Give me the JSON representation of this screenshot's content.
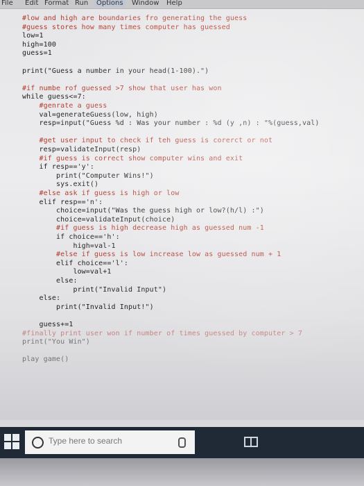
{
  "menu": {
    "file": "File",
    "edit": "Edit",
    "format": "Format",
    "run": "Run",
    "options": "Options",
    "window": "Window",
    "help": "Help"
  },
  "code": [
    {
      "text": "#low and high are boundaries fro generating the guess",
      "kind": "cm"
    },
    {
      "text": "#guess stores how many times computer has guessed",
      "kind": "cm"
    },
    {
      "text": "low=1",
      "kind": "plain"
    },
    {
      "text": "high=100",
      "kind": "plain"
    },
    {
      "text": "guess=1",
      "kind": "plain"
    },
    {
      "text": "",
      "kind": "plain"
    },
    {
      "text": "print(\"Guess a number in your head(1-100).\")",
      "kind": "plain"
    },
    {
      "text": "",
      "kind": "plain"
    },
    {
      "text": "#if numbe rof guessed >7 show that user has won",
      "kind": "cm"
    },
    {
      "text": "while guess<=7:",
      "kind": "plain"
    },
    {
      "text": "    #genrate a guess",
      "kind": "cm"
    },
    {
      "text": "    val=generateGuess(low, high)",
      "kind": "plain"
    },
    {
      "text": "    resp=input(\"Guess %d : Was your number : %d (y ,n) : \"%(guess,val)",
      "kind": "plain"
    },
    {
      "text": "",
      "kind": "plain"
    },
    {
      "text": "    #get user input to check if teh guess is corerct or not",
      "kind": "cm"
    },
    {
      "text": "    resp=validateInput(resp)",
      "kind": "plain"
    },
    {
      "text": "    #if guess is correct show computer wins and exit",
      "kind": "cm"
    },
    {
      "text": "    if resp=='y':",
      "kind": "plain"
    },
    {
      "text": "        print(\"Computer Wins!\")",
      "kind": "plain"
    },
    {
      "text": "        sys.exit()",
      "kind": "plain"
    },
    {
      "text": "    #else ask if guess is high or low",
      "kind": "cm"
    },
    {
      "text": "    elif resp=='n':",
      "kind": "plain"
    },
    {
      "text": "        choice=input(\"Was the guess high or low?(h/l) :\")",
      "kind": "plain"
    },
    {
      "text": "        choice=validateInput(choice)",
      "kind": "plain"
    },
    {
      "text": "        #if guess is high decrease high as guessed num -1",
      "kind": "cm"
    },
    {
      "text": "        if choice=='h':",
      "kind": "plain"
    },
    {
      "text": "            high=val-1",
      "kind": "plain"
    },
    {
      "text": "        #else if guess is low increase low as guessed num + 1",
      "kind": "cm"
    },
    {
      "text": "        elif choice=='l':",
      "kind": "plain"
    },
    {
      "text": "            low=val+1",
      "kind": "plain"
    },
    {
      "text": "        else:",
      "kind": "plain"
    },
    {
      "text": "            print(\"Invalid Input\")",
      "kind": "plain"
    },
    {
      "text": "    else:",
      "kind": "plain"
    },
    {
      "text": "        print(\"Invalid Input!\")",
      "kind": "plain"
    },
    {
      "text": "",
      "kind": "plain"
    },
    {
      "text": "    guess+=1",
      "kind": "plain"
    },
    {
      "text": "#finally print user won if number of times guessed by computer > 7",
      "kind": "cm"
    },
    {
      "text": "print(\"You Win\")",
      "kind": "plain"
    },
    {
      "text": "",
      "kind": "plain"
    },
    {
      "text": "play game()",
      "kind": "plain"
    }
  ],
  "taskbar": {
    "search_placeholder": "Type here to search",
    "icons": [
      "windows-start-icon",
      "search-circle-icon",
      "microphone-icon",
      "task-view-icon"
    ]
  },
  "colors": {
    "comment": "#b23a2c",
    "keyword": "#e07a2a",
    "string": "#2f8f3a",
    "taskbar": "#1f2a36"
  }
}
